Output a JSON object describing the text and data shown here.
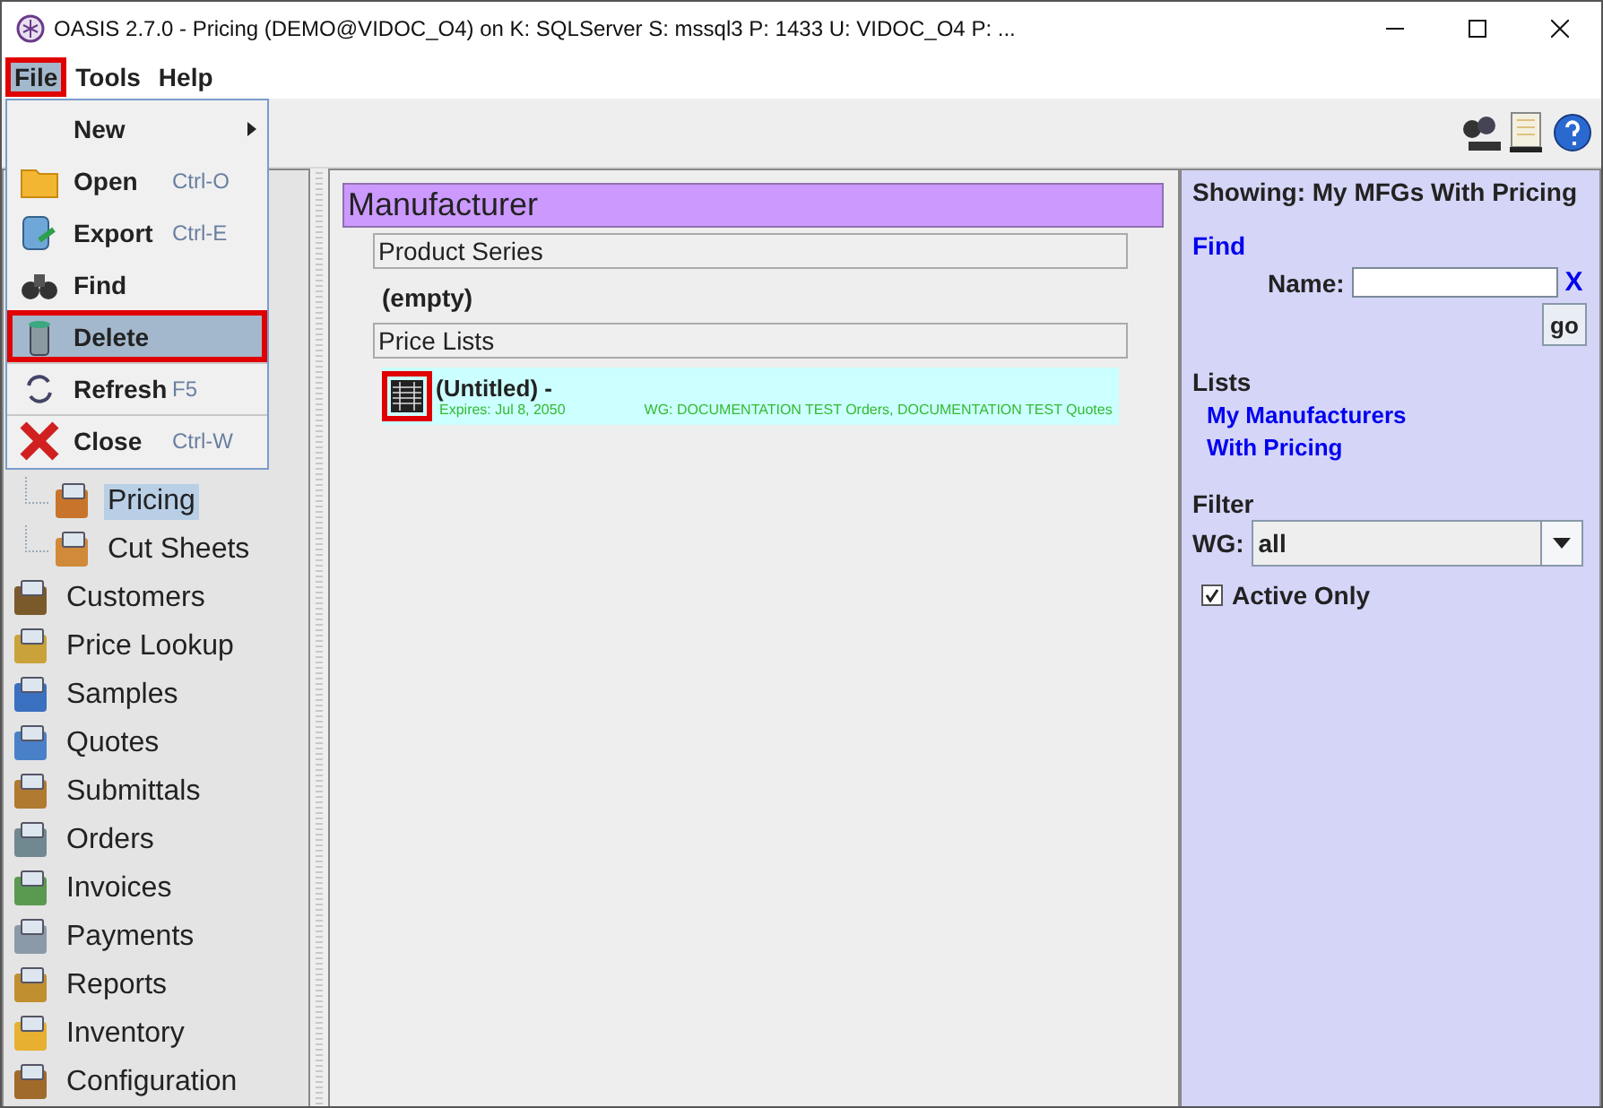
{
  "window": {
    "title": "OASIS 2.7.0 - Pricing (DEMO@VIDOC_O4) on K: SQLServer  S: mssql3  P: 1433  U: VIDOC_O4  P: ..."
  },
  "menu_bar": [
    {
      "label": "File",
      "selected": true,
      "marked": true
    },
    {
      "label": "Tools",
      "selected": false,
      "marked": false
    },
    {
      "label": "Help",
      "selected": false,
      "marked": false
    }
  ],
  "file_menu": [
    {
      "label": "New",
      "kind": "submenu",
      "selected": false,
      "marked": false,
      "separator_before": false
    },
    {
      "label": "Open",
      "kind": "open",
      "shortcut": "Ctrl-O",
      "selected": false,
      "marked": false,
      "separator_before": false
    },
    {
      "label": "Export",
      "kind": "export",
      "shortcut": "Ctrl-E",
      "selected": false,
      "marked": false,
      "separator_before": false
    },
    {
      "label": "Find",
      "kind": "find",
      "selected": false,
      "marked": false,
      "separator_before": false
    },
    {
      "label": "Delete",
      "kind": "delete",
      "selected": true,
      "marked": true,
      "separator_before": false
    },
    {
      "label": "Refresh",
      "kind": "refresh",
      "shortcut": "F5",
      "selected": false,
      "marked": false,
      "separator_before": true
    },
    {
      "label": "Close",
      "kind": "close",
      "shortcut": "Ctrl-W",
      "selected": false,
      "marked": false,
      "separator_before": true
    }
  ],
  "sidebar": {
    "items": [
      {
        "children": [
          {
            "label": "Pricing",
            "selected": true
          },
          {
            "label": "Cut Sheets",
            "selected": false
          }
        ]
      },
      {
        "label": "Customers",
        "selected": false
      },
      {
        "label": "Price Lookup",
        "selected": false
      },
      {
        "label": "Samples",
        "selected": false
      },
      {
        "label": "Quotes",
        "selected": false
      },
      {
        "label": "Submittals",
        "selected": false
      },
      {
        "label": "Orders",
        "selected": false
      },
      {
        "label": "Invoices",
        "selected": false
      },
      {
        "label": "Payments",
        "selected": false
      },
      {
        "label": "Reports",
        "selected": false
      },
      {
        "label": "Inventory",
        "selected": false
      },
      {
        "label": "Configuration",
        "selected": false
      }
    ]
  },
  "main": {
    "header": "Manufacturer",
    "sections": [
      {
        "title": "Product Series",
        "empty_text": "(empty)"
      },
      {
        "title": "Price Lists",
        "items": [
          {
            "title": "(Untitled) -",
            "expires": "Expires: Jul 8, 2050",
            "wg": "WG: DOCUMENTATION TEST Orders, DOCUMENTATION TEST Quotes",
            "marked": true
          }
        ]
      }
    ]
  },
  "right_panel": {
    "showing": "Showing: My MFGs With Pricing",
    "find_title": "Find",
    "name_label": "Name:",
    "clear": "X",
    "go": "go",
    "lists_title": "Lists",
    "lists": [
      "My Manufacturers",
      "With Pricing"
    ],
    "filter_title": "Filter",
    "wg_label": "WG:",
    "wg_value": "all",
    "active_only": {
      "label": "Active Only",
      "checked": true
    }
  }
}
